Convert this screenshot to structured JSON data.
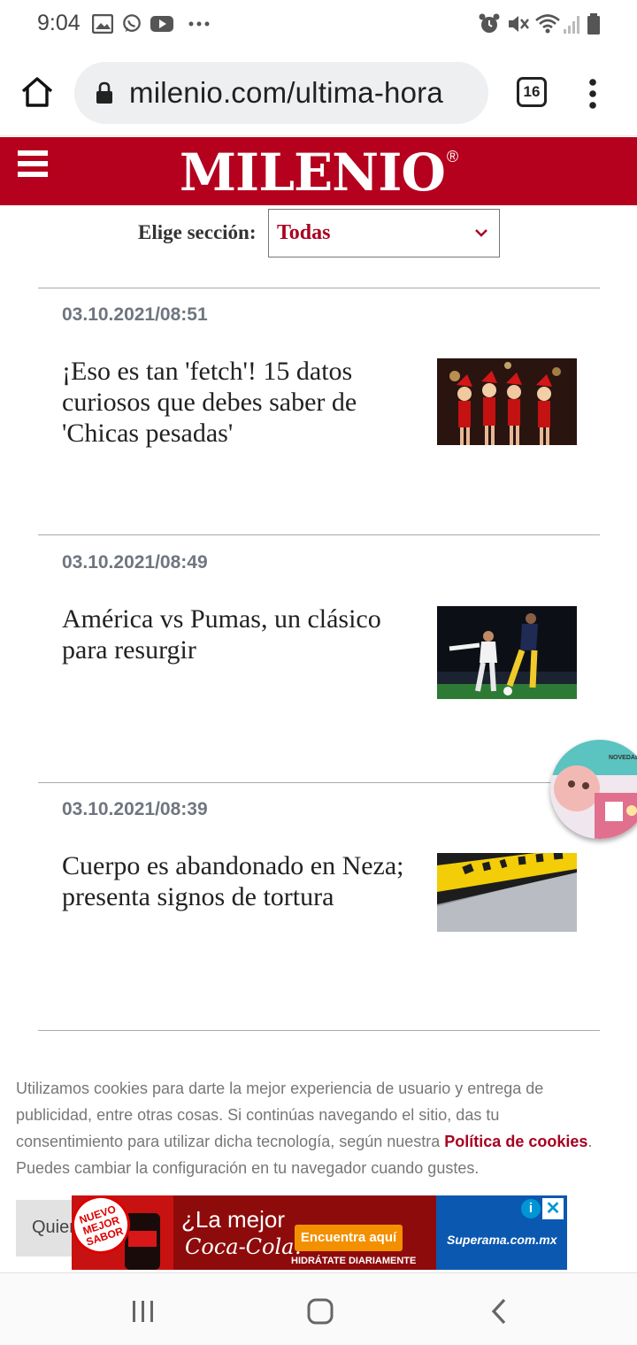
{
  "status_bar": {
    "time": "9:04",
    "notification_icons": [
      "gallery-icon",
      "whatsapp-icon",
      "youtube-icon",
      "more-dots-icon"
    ],
    "system_icons": [
      "alarm-icon",
      "mute-icon",
      "wifi-icon",
      "signal-icon",
      "battery-icon"
    ]
  },
  "browser": {
    "url": "milenio.com/ultima-hora",
    "tab_count": "16"
  },
  "site": {
    "logo": "MILENIO",
    "logo_mark": "®",
    "brand_color": "#b5001e"
  },
  "section_selector": {
    "label": "Elige sección:",
    "selected": "Todas"
  },
  "articles": [
    {
      "date": "03.10.2021/08:51",
      "title": "¡Eso es tan 'fetch'! 15 datos curiosos que debes saber de 'Chicas pesadas'"
    },
    {
      "date": "03.10.2021/08:49",
      "title": "América vs Pumas, un clásico para resurgir"
    },
    {
      "date": "03.10.2021/08:39",
      "title": "Cuerpo es abandonado en Neza; presenta signos de tortura"
    }
  ],
  "cookie_notice": {
    "text_before": "Utilizamos cookies para darte la mejor experiencia de usuario y entrega de publicidad, entre otras cosas. Si continúas navegando el sitio, das tu consentimiento para utilizar dicha tecnología, según nuestra ",
    "link": "Política de cookies",
    "text_after": ". Puedes cambiar la configuración en tu navegador cuando gustes.",
    "button": "Quier"
  },
  "ad": {
    "badge": "NUEVO MEJOR SABOR",
    "headline": "¿La mejor",
    "brand": "Coca-Cola?",
    "cta": "Encuentra aquí",
    "subline": "HIDRÁTATE DIARIAMENTE",
    "store": "Superama.com.mx",
    "info": "i",
    "close": "✕"
  },
  "chat_bubble": {
    "text": "NOVEDADES EN NIÑAS"
  }
}
